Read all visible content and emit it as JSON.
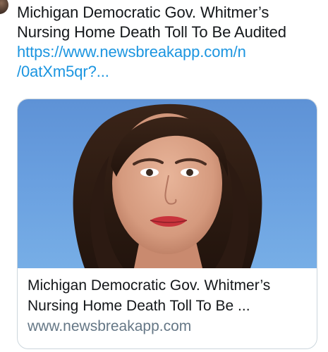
{
  "tweet": {
    "text_line1": "Michigan Democratic Gov. Whitmer’s",
    "text_line2": "Nursing Home Death Toll To Be Audited",
    "link_line1": "https://www.newsbreakapp.com/n",
    "link_line2": "/0atXm5qr?..."
  },
  "card": {
    "title_line1": "Michigan Democratic Gov. Whitmer’s",
    "title_line2": "Nursing Home Death Toll To Be ...",
    "domain": "www.newsbreakapp.com"
  },
  "colors": {
    "link": "#1b95e0",
    "text": "#14171a",
    "secondary": "#657786",
    "card_border": "#ccd6dd",
    "image_background": "#6aa0e0"
  }
}
